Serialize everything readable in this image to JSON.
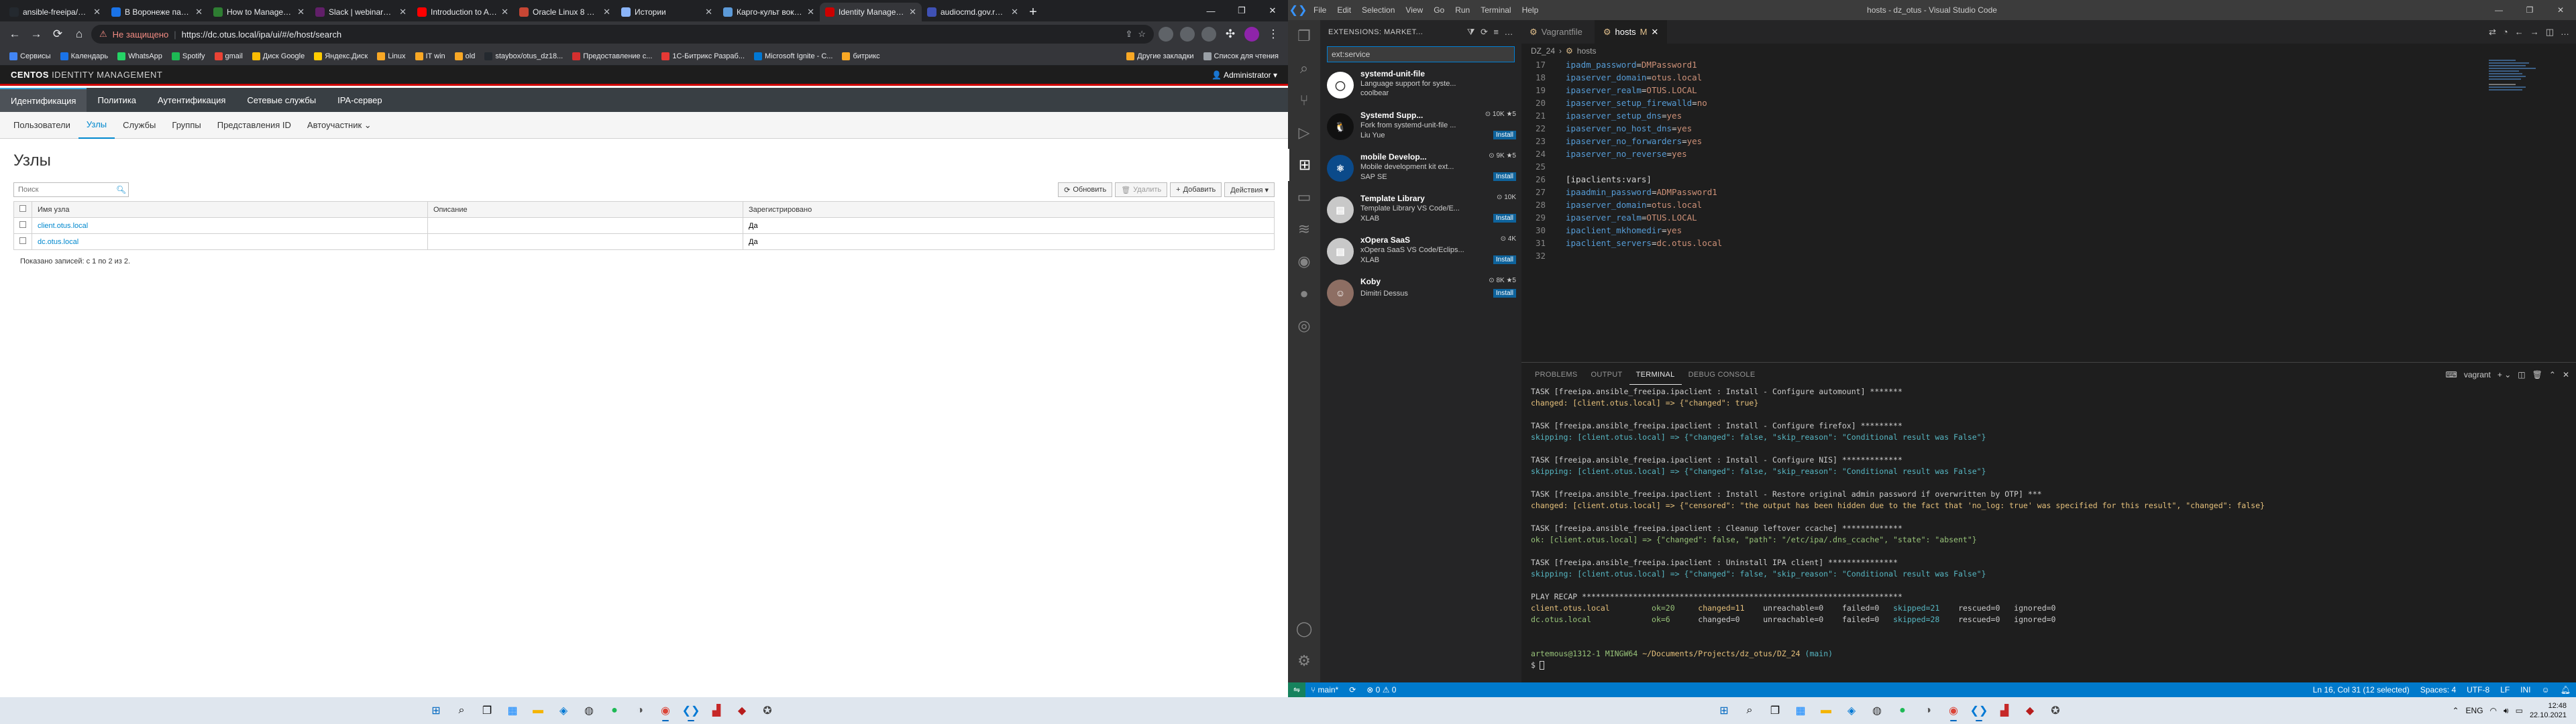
{
  "chrome": {
    "tabs": [
      {
        "title": "ansible-freeipa/RE..",
        "color": "#24292f",
        "active": false
      },
      {
        "title": "В Воронеже пацие...",
        "color": "#1a73e8",
        "active": false
      },
      {
        "title": "How to Manage Ho...",
        "color": "#2e7d32",
        "active": false
      },
      {
        "title": "Slack | webinars-20...",
        "color": "#611f69",
        "active": false
      },
      {
        "title": "Introduction to Aut...",
        "color": "#ff0000",
        "active": false
      },
      {
        "title": "Oracle Linux 8 Tra...",
        "color": "#c74634",
        "active": false
      },
      {
        "title": "Истории",
        "color": "#8ab4f8",
        "active": false
      },
      {
        "title": "Карго-культ вокру...",
        "color": "#5c9ad8",
        "active": false
      },
      {
        "title": "Identity Managem...",
        "color": "#cc0000",
        "active": true
      },
      {
        "title": "audiocmd.gov.ru/m...",
        "color": "#3f51b5",
        "active": false
      }
    ],
    "security_warning": "Не защищено",
    "url": "https://dc.otus.local/ipa/ui/#/e/host/search",
    "bookmarks": [
      {
        "label": "Сервисы",
        "color": "#4285f4"
      },
      {
        "label": "Календарь",
        "color": "#1a73e8"
      },
      {
        "label": "WhatsApp",
        "color": "#25d366"
      },
      {
        "label": "Spotify",
        "color": "#1db954"
      },
      {
        "label": "gmail",
        "color": "#ea4335"
      },
      {
        "label": "Диск Google",
        "color": "#fbbc04"
      },
      {
        "label": "Яндекс.Диск",
        "color": "#ffcc00"
      },
      {
        "label": "Linux",
        "color": "#f9a825"
      },
      {
        "label": "IT win",
        "color": "#f9a825"
      },
      {
        "label": "old",
        "color": "#f9a825"
      },
      {
        "label": "staybox/otus_dz18...",
        "color": "#24292f"
      },
      {
        "label": "Предоставление с...",
        "color": "#d32f2f"
      },
      {
        "label": "1С-Битрикс Разраб...",
        "color": "#e53935"
      },
      {
        "label": "Microsoft Ignite - C...",
        "color": "#0078d4"
      },
      {
        "label": "битрикс",
        "color": "#f9a825"
      },
      {
        "label": "Другие закладки",
        "color": "#f9a825"
      },
      {
        "label": "Список для чтения",
        "color": "#9aa0a6"
      }
    ]
  },
  "ipa": {
    "brand_bold": "CENTOS",
    "brand_rest": "IDENTITY MANAGEMENT",
    "user": "Administrator ▾",
    "main_nav": [
      "Идентификация",
      "Политика",
      "Аутентификация",
      "Сетевые службы",
      "IPA-сервер"
    ],
    "sub_nav": [
      "Пользователи",
      "Узлы",
      "Службы",
      "Группы",
      "Представления ID",
      "Автоучастник ⌄"
    ],
    "title": "Узлы",
    "search_placeholder": "Поиск",
    "actions": {
      "refresh": "Обновить",
      "delete": "Удалить",
      "add": "Добавить",
      "more": "Действия ▾"
    },
    "columns": [
      "Имя узла",
      "Описание",
      "Зарегистрировано"
    ],
    "rows": [
      {
        "name": "client.otus.local",
        "description": "",
        "registered": "Да"
      },
      {
        "name": "dc.otus.local",
        "description": "",
        "registered": "Да"
      }
    ],
    "footer": "Показано записей: с 1 по 2 из 2."
  },
  "vscode": {
    "menu": [
      "File",
      "Edit",
      "Selection",
      "View",
      "Go",
      "Run",
      "Terminal",
      "Help"
    ],
    "window_title": "hosts - dz_otus - Visual Studio Code",
    "sidebar_title": "EXTENSIONS: MARKET...",
    "search_value": "ext:service",
    "extensions": [
      {
        "name": "systemd-unit-file",
        "meta": "",
        "desc": "Language support for syste...",
        "publisher": "coolbear",
        "color": "#ffffff",
        "glyph": "◯",
        "install": false
      },
      {
        "name": "Systemd Supp...",
        "meta": "⊙ 10K ★5",
        "desc": "Fork from systemd-unit-file ...",
        "publisher": "Liu Yue",
        "color": "#111111",
        "glyph": "🐧",
        "install": true
      },
      {
        "name": "mobile Develop...",
        "meta": "⊙ 9K ★5",
        "desc": "Mobile development kit ext...",
        "publisher": "SAP SE",
        "color": "#0b4a8a",
        "glyph": "⚛",
        "install": true
      },
      {
        "name": "Template Library",
        "meta": "⊙ 10K",
        "desc": "Template Library VS Code/E...",
        "publisher": "XLAB",
        "color": "#c8c8c8",
        "glyph": "▤",
        "install": true
      },
      {
        "name": "xOpera SaaS",
        "meta": "⊙ 4K",
        "desc": "xOpera SaaS VS Code/Eclips...",
        "publisher": "XLAB",
        "color": "#c8c8c8",
        "glyph": "▤",
        "install": true
      },
      {
        "name": "Koby",
        "meta": "⊙ 8K ★5",
        "desc": "",
        "publisher": "Dimitri Dessus",
        "color": "#8d6e63",
        "glyph": "☺",
        "install": true
      }
    ],
    "editor_tabs": [
      {
        "label": "Vagrantfile",
        "mod": "",
        "active": false
      },
      {
        "label": "hosts",
        "mod": "M",
        "active": true
      }
    ],
    "breadcrumb": [
      "DZ_24",
      "hosts"
    ],
    "code_lines": [
      {
        "n": "17",
        "k": "ipadm_password",
        "v": "DMPassword1"
      },
      {
        "n": "18",
        "k": "ipaserver_domain",
        "v": "otus.local"
      },
      {
        "n": "19",
        "k": "ipaserver_realm",
        "v": "OTUS.LOCAL"
      },
      {
        "n": "20",
        "k": "ipaserver_setup_firewalld",
        "v": "no"
      },
      {
        "n": "21",
        "k": "ipaserver_setup_dns",
        "v": "yes"
      },
      {
        "n": "22",
        "k": "ipaserver_no_host_dns",
        "v": "yes"
      },
      {
        "n": "23",
        "k": "ipaserver_no_forwarders",
        "v": "yes"
      },
      {
        "n": "24",
        "k": "ipaserver_no_reverse",
        "v": "yes"
      },
      {
        "n": "25",
        "k": "",
        "v": ""
      },
      {
        "n": "26",
        "k": "",
        "v": "",
        "sec": "[ipaclients:vars]"
      },
      {
        "n": "27",
        "k": "ipaadmin_password",
        "v": "ADMPassword1"
      },
      {
        "n": "28",
        "k": "ipaserver_domain",
        "v": "otus.local"
      },
      {
        "n": "29",
        "k": "ipaserver_realm",
        "v": "OTUS.LOCAL"
      },
      {
        "n": "30",
        "k": "ipaclient_mkhomedir",
        "v": "yes"
      },
      {
        "n": "31",
        "k": "ipaclient_servers",
        "v": "dc.otus.local"
      },
      {
        "n": "32",
        "k": "",
        "v": ""
      }
    ],
    "panel_tabs": [
      "PROBLEMS",
      "OUTPUT",
      "TERMINAL",
      "DEBUG CONSOLE"
    ],
    "terminal_name": "vagrant",
    "terminal_lines": [
      {
        "t": "TASK [freeipa.ansible_freeipa.ipaclient : Install - Configure automount] *******",
        "c": ""
      },
      {
        "t": "changed: [client.otus.local] => {\"changed\": true}",
        "c": "chg"
      },
      {
        "t": "",
        "c": ""
      },
      {
        "t": "TASK [freeipa.ansible_freeipa.ipaclient : Install - Configure firefox] *********",
        "c": ""
      },
      {
        "t": "skipping: [client.otus.local] => {\"changed\": false, \"skip_reason\": \"Conditional result was False\"}",
        "c": "skp"
      },
      {
        "t": "",
        "c": ""
      },
      {
        "t": "TASK [freeipa.ansible_freeipa.ipaclient : Install - Configure NIS] *************",
        "c": ""
      },
      {
        "t": "skipping: [client.otus.local] => {\"changed\": false, \"skip_reason\": \"Conditional result was False\"}",
        "c": "skp"
      },
      {
        "t": "",
        "c": ""
      },
      {
        "t": "TASK [freeipa.ansible_freeipa.ipaclient : Install - Restore original admin password if overwritten by OTP] ***",
        "c": ""
      },
      {
        "t": "changed: [client.otus.local] => {\"censored\": \"the output has been hidden due to the fact that 'no_log: true' was specified for this result\", \"changed\": false}",
        "c": "chg"
      },
      {
        "t": "",
        "c": ""
      },
      {
        "t": "TASK [freeipa.ansible_freeipa.ipaclient : Cleanup leftover ccache] *************",
        "c": ""
      },
      {
        "t": "ok: [client.otus.local] => {\"changed\": false, \"path\": \"/etc/ipa/.dns_ccache\", \"state\": \"absent\"}",
        "c": "ok"
      },
      {
        "t": "",
        "c": ""
      },
      {
        "t": "TASK [freeipa.ansible_freeipa.ipaclient : Uninstall IPA client] ***************",
        "c": ""
      },
      {
        "t": "skipping: [client.otus.local] => {\"changed\": false, \"skip_reason\": \"Conditional result was False\"}",
        "c": "skp"
      },
      {
        "t": "",
        "c": ""
      },
      {
        "t": "PLAY RECAP *********************************************************************",
        "c": ""
      }
    ],
    "recap": [
      {
        "host": "client.otus.local",
        "ok": "ok=20",
        "changed": "changed=11",
        "unreachable": "unreachable=0",
        "failed": "failed=0",
        "skipped": "skipped=21",
        "rescued": "rescued=0",
        "ignored": "ignored=0"
      },
      {
        "host": "dc.otus.local",
        "ok": "ok=6",
        "changed": "changed=0",
        "unreachable": "unreachable=0",
        "failed": "failed=0",
        "skipped": "skipped=28",
        "rescued": "rescued=0",
        "ignored": "ignored=0"
      }
    ],
    "prompt_user": "artemous@1312-1 MINGW64",
    "prompt_path": "~/Documents/Projects/dz_otus/DZ_24",
    "prompt_branch": "(main)",
    "prompt_sym": "$",
    "status": {
      "branch": "main*",
      "sync": "⟳",
      "problems": "⊗ 0 ⚠ 0",
      "position": "Ln 16, Col 31 (12 selected)",
      "spaces": "Spaces: 4",
      "encoding": "UTF-8",
      "eol": "LF",
      "lang": "INI"
    }
  },
  "taskbar": {
    "lang": "ENG",
    "time": "12:48",
    "date": "22.10.2021"
  }
}
